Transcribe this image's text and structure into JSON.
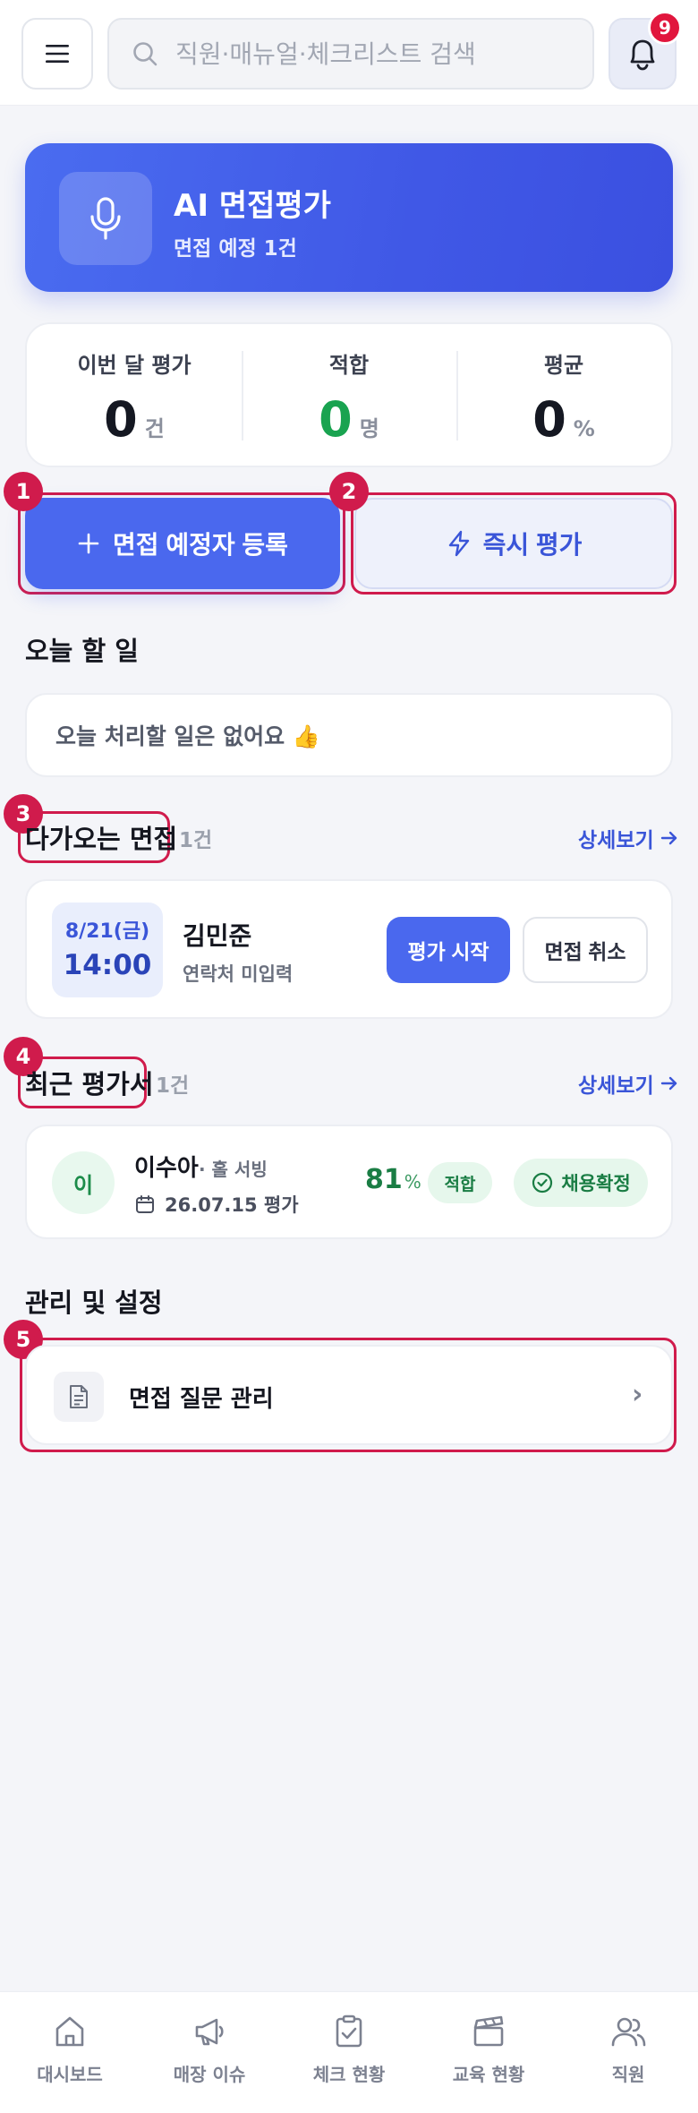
{
  "header": {
    "search_placeholder": "직원·매뉴얼·체크리스트 검색",
    "notification_count": "9"
  },
  "ai_card": {
    "title": "AI 면접평가",
    "subtitle": "면접 예정 1건"
  },
  "stats": [
    {
      "label": "이번 달 평가",
      "value": "0",
      "unit": "건"
    },
    {
      "label": "적합",
      "value": "0",
      "unit": "명"
    },
    {
      "label": "평균",
      "value": "0",
      "unit": "%"
    }
  ],
  "actions": {
    "register_label": "면접 예정자 등록",
    "instant_label": "즉시 평가"
  },
  "markers": [
    "1",
    "2",
    "3",
    "4",
    "5"
  ],
  "today": {
    "title": "오늘 할 일",
    "empty_message": "오늘 처리할 일은 없어요 👍"
  },
  "upcoming": {
    "title": "다가오는 면접",
    "count": "1건",
    "more": "상세보기",
    "item": {
      "date": "8/21(금)",
      "time": "14:00",
      "name": "김민준",
      "contact": "연락처 미입력",
      "start_label": "평가 시작",
      "cancel_label": "면접 취소"
    }
  },
  "recent": {
    "title": "최근 평가서",
    "count": "1건",
    "more": "상세보기",
    "item": {
      "avatar": "이",
      "name": "이수아",
      "role": "· 홀 서빙",
      "date": "26.07.15 평가",
      "score": "81",
      "score_unit": "%",
      "fit": "적합",
      "status": "채용확정"
    }
  },
  "settings": {
    "title": "관리 및 설정",
    "item_label": "면접 질문 관리",
    "chevron": "›"
  },
  "bottom_nav": [
    {
      "label": "대시보드",
      "icon": "home-icon"
    },
    {
      "label": "매장 이슈",
      "icon": "megaphone-icon"
    },
    {
      "label": "체크 현황",
      "icon": "clipboard-check-icon"
    },
    {
      "label": "교육 현황",
      "icon": "clapperboard-icon"
    },
    {
      "label": "직원",
      "icon": "users-icon"
    }
  ],
  "colors": {
    "primary": "#4a68ee",
    "accent_red": "#d01b4c",
    "success": "#19a350",
    "background": "#f4f5f9"
  }
}
